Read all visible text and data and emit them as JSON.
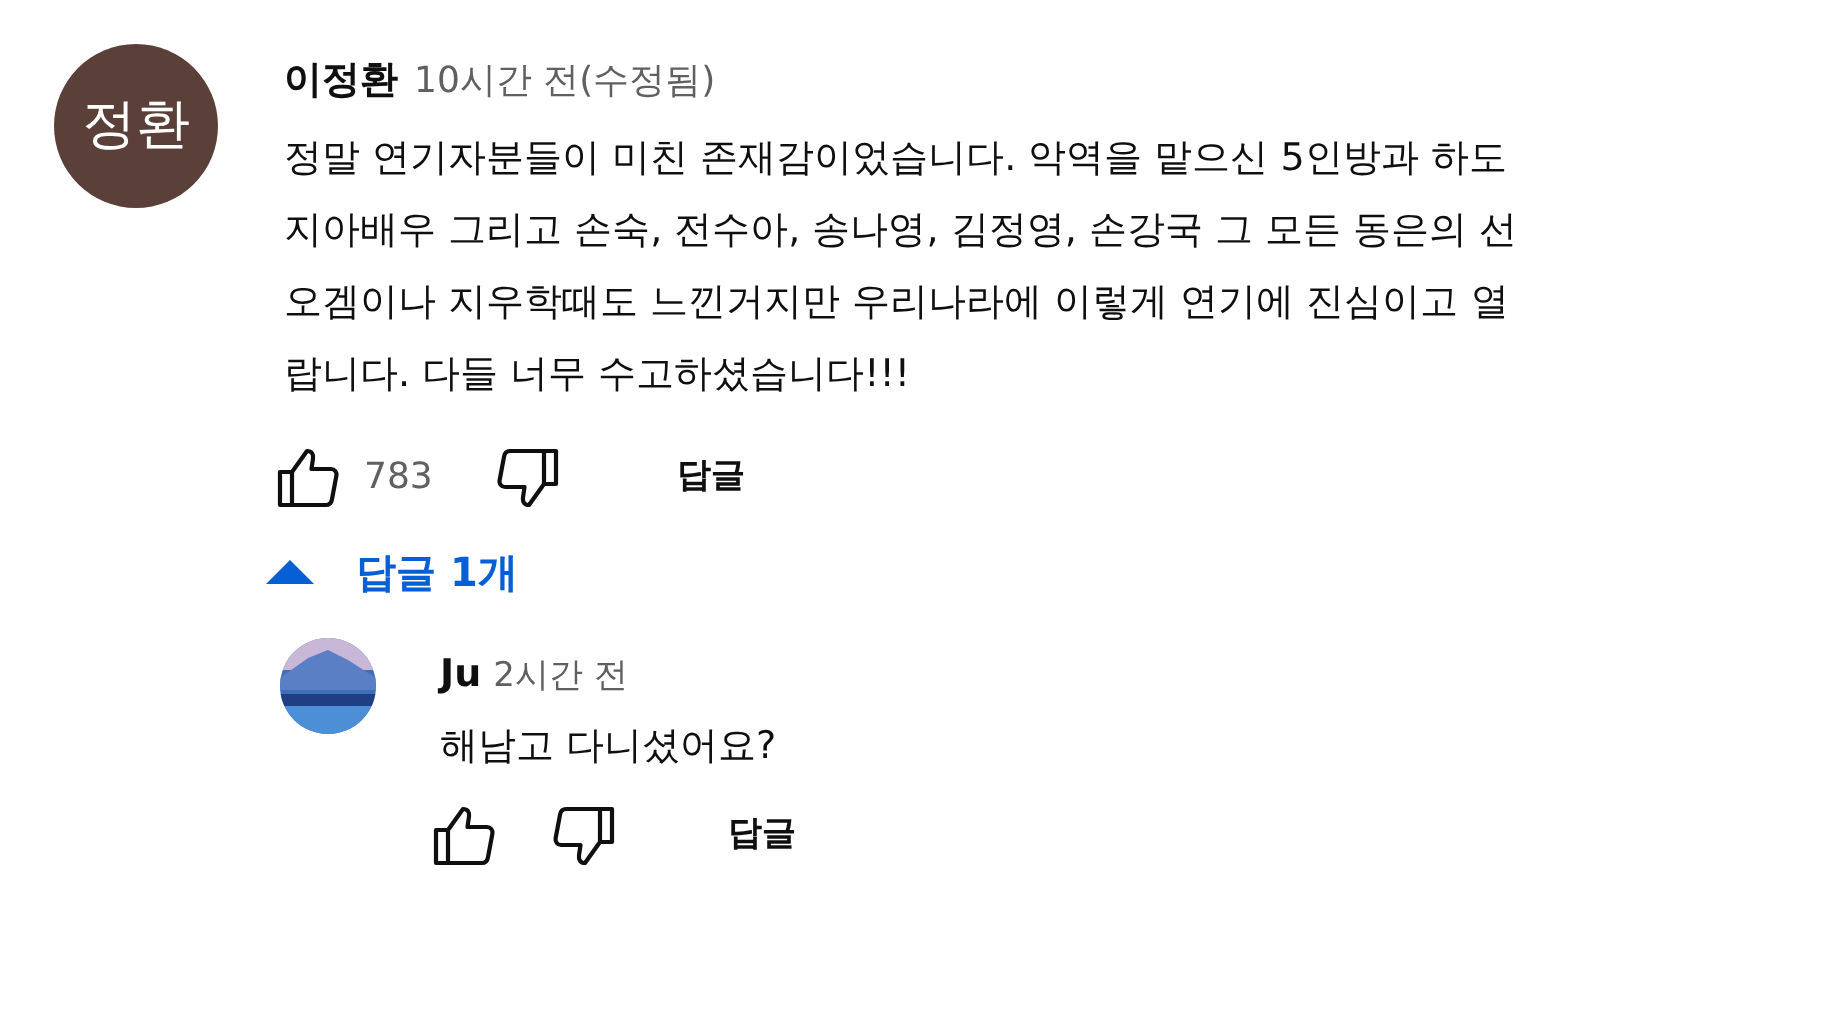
{
  "comment": {
    "avatar_text": "정환",
    "author": "이정환",
    "time": "10시간 전(수정됨)",
    "lines": [
      "정말 연기자분들이 미친 존재감이었습니다. 악역을 맡으신 5인방과 하도",
      "지아배우 그리고 손숙, 전수아, 송나영, 김정영, 손강국 그 모든 동은의 선",
      "오겜이나 지우학때도 느낀거지만 우리나라에 이렇게 연기에 진심이고 열",
      "랍니다. 다들 너무 수고하셨습니다!!!"
    ],
    "likes": "783",
    "reply_button": "답글"
  },
  "replies_toggle": {
    "label": "답글 1개",
    "expanded": true
  },
  "replies": [
    {
      "author": "Ju",
      "time": "2시간 전",
      "text": "해남고 다니셨어요?",
      "reply_button": "답글"
    }
  ]
}
